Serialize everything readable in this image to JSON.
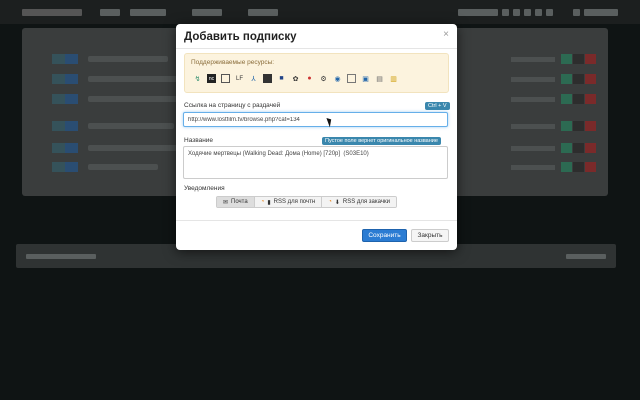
{
  "modal": {
    "title": "Добавить подписку",
    "close_glyph": "×",
    "resources_label": "Поддерживаемые ресурсы:",
    "resource_icons": [
      "rutracker-icon",
      "nnm-club-icon",
      "kinozal-icon",
      "lostfilm-icon",
      "anidub-icon",
      "anilibria-icon",
      "baibako-icon",
      "casstudio-icon",
      "free-torrents-icon",
      "hamsterstudio-icon",
      "newstudio-icon",
      "pornolab-icon",
      "rutor-icon",
      "tfile-icon",
      "tr-anime-icon"
    ],
    "url_label": "Ссылка на страницу с раздачей",
    "url_hint": "Ctrl + V",
    "url_value": "http://www.lostfilm.tv/browse.php?cat=134",
    "name_label": "Название",
    "name_hint": "Пустое поле вернет оригинальное название",
    "name_value": "Ходячие мертвецы (Walking Dead: Дома (Home) [720p]  (S03E10)",
    "notifications_label": "Уведомления",
    "notif_email": "Почта",
    "notif_rss_all": "RSS для почтн",
    "notif_rss_dl": "RSS для закачки",
    "save_label": "Сохранить",
    "close_label": "Закрыть"
  }
}
